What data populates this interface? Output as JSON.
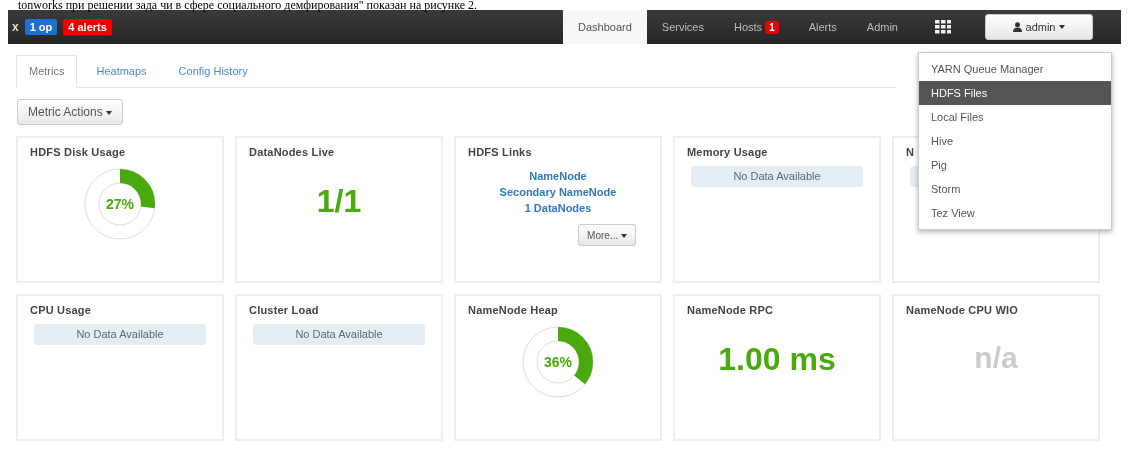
{
  "document_text": "tonworks при решении зада чи в сфере социального демфирования\" показан на рисунке 2.",
  "navbar": {
    "logo_text": "x",
    "ops_badge": "1 op",
    "alerts_badge": "4 alerts",
    "tabs": [
      {
        "label": "Dashboard",
        "selected": true
      },
      {
        "label": "Services",
        "selected": false
      },
      {
        "label": "Hosts",
        "selected": false,
        "badge": "1"
      },
      {
        "label": "Alerts",
        "selected": false
      },
      {
        "label": "Admin",
        "selected": false
      }
    ],
    "user_button": "admin"
  },
  "sub_tabs": [
    {
      "label": "Metrics",
      "selected": true
    },
    {
      "label": "Heatmaps",
      "selected": false
    },
    {
      "label": "Config History",
      "selected": false
    }
  ],
  "actions_button": "Metric Actions",
  "widgets": [
    {
      "title": "HDFS Disk Usage",
      "kind": "donut",
      "level": 0.27,
      "value": "27%"
    },
    {
      "title": "DataNodes Live",
      "kind": "number",
      "value": "1/1"
    },
    {
      "title": "HDFS Links",
      "kind": "links",
      "links": [
        "NameNode",
        "Secondary NameNode",
        "1 DataNodes"
      ],
      "more": "More..."
    },
    {
      "title": "Memory Usage",
      "kind": "nodata",
      "value": "No Data Available"
    },
    {
      "title": "N",
      "kind": "nodata"
    },
    {
      "title": "CPU Usage",
      "kind": "nodata",
      "value": "No Data Available"
    },
    {
      "title": "Cluster Load",
      "kind": "nodata",
      "value": "No Data Available"
    },
    {
      "title": "NameNode Heap",
      "kind": "donut",
      "level": 0.36,
      "value": "36%"
    },
    {
      "title": "NameNode RPC",
      "kind": "number",
      "value": "1.00 ms"
    },
    {
      "title": "NameNode CPU WIO",
      "kind": "na",
      "value": "n/a"
    }
  ],
  "views_menu": [
    {
      "label": "YARN Queue Manager",
      "selected": false
    },
    {
      "label": "HDFS Files",
      "selected": true
    },
    {
      "label": "Local Files",
      "selected": false
    },
    {
      "label": "Hive",
      "selected": false
    },
    {
      "label": "Pig",
      "selected": false
    },
    {
      "label": "Storm",
      "selected": false
    },
    {
      "label": "Tez View",
      "selected": false
    }
  ]
}
